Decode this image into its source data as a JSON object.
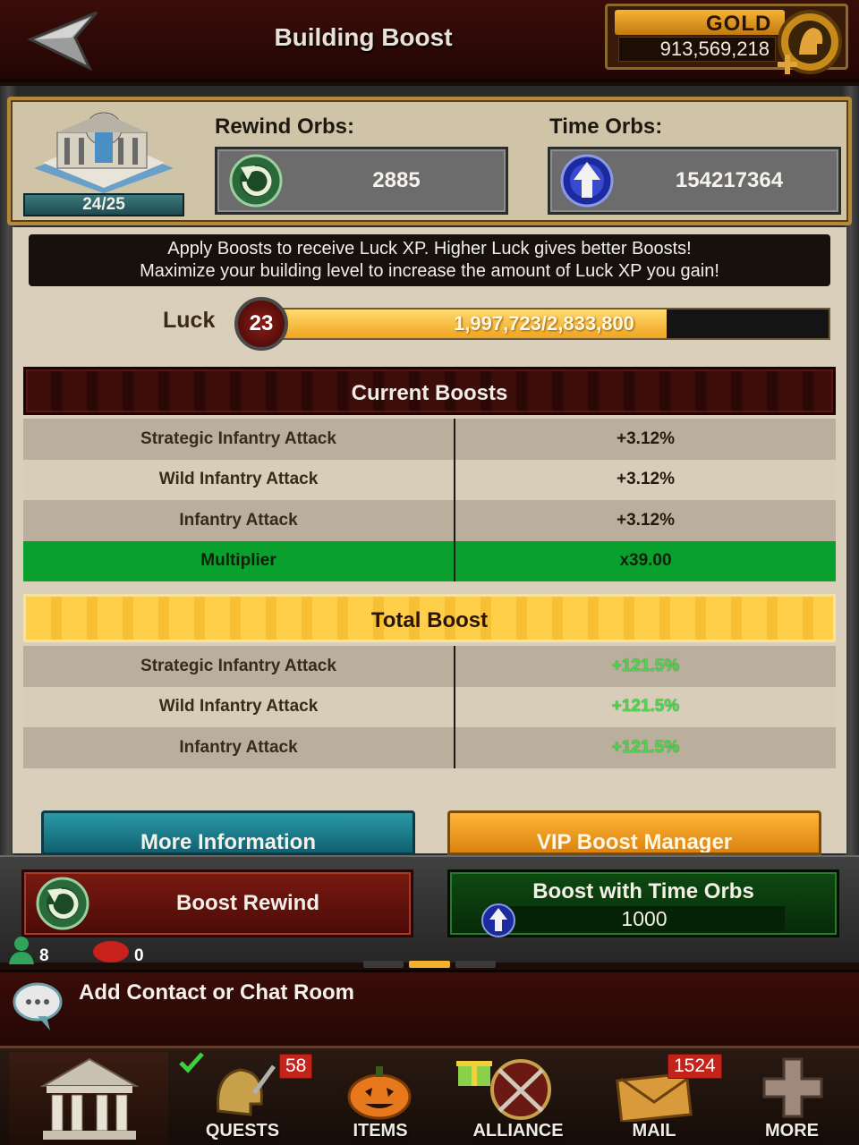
{
  "header": {
    "title": "Building Boost",
    "gold_label": "GOLD",
    "gold_value": "913,569,218"
  },
  "orbs": {
    "level": "24/25",
    "rewind_label": "Rewind Orbs:",
    "rewind_value": "2885",
    "time_label": "Time Orbs:",
    "time_value": "154217364"
  },
  "info": {
    "line1": "Apply Boosts to receive Luck XP. Higher Luck gives better Boosts!",
    "line2": "Maximize your building level to increase the amount of Luck XP you gain!"
  },
  "luck": {
    "label": "Luck",
    "level": "23",
    "progress_text": "1,997,723/2,833,800",
    "progress_fraction": 0.705
  },
  "current_boosts": {
    "title": "Current Boosts",
    "rows": [
      {
        "name": "Strategic Infantry Attack",
        "value": "+3.12%"
      },
      {
        "name": "Wild Infantry Attack",
        "value": "+3.12%"
      },
      {
        "name": "Infantry Attack",
        "value": "+3.12%"
      },
      {
        "name": "Multiplier",
        "value": "x39.00"
      }
    ]
  },
  "total_boost": {
    "title": "Total Boost",
    "rows": [
      {
        "name": "Strategic Infantry Attack",
        "value": "+121.5%"
      },
      {
        "name": "Wild Infantry Attack",
        "value": "+121.5%"
      },
      {
        "name": "Infantry Attack",
        "value": "+121.5%"
      }
    ]
  },
  "buttons": {
    "more_info": "More Information",
    "vip_manager": "VIP Boost Manager",
    "boost_rewind": "Boost Rewind",
    "boost_time_orbs": "Boost with Time Orbs",
    "time_orbs_cost": "1000"
  },
  "presence": {
    "online_count": "8",
    "message_count": "0"
  },
  "chat": {
    "placeholder": "Add Contact or Chat Room"
  },
  "nav": {
    "quests": {
      "label": "QUESTS",
      "badge": "58"
    },
    "items": {
      "label": "ITEMS"
    },
    "alliance": {
      "label": "ALLIANCE"
    },
    "mail": {
      "label": "MAIL",
      "badge": "1524"
    },
    "more": {
      "label": "MORE"
    }
  },
  "colors": {
    "gold_accent": "#f0a420",
    "multiplier_green": "#0aa02d",
    "total_green": "#4ad94a",
    "header_red": "#3a0d0a"
  }
}
